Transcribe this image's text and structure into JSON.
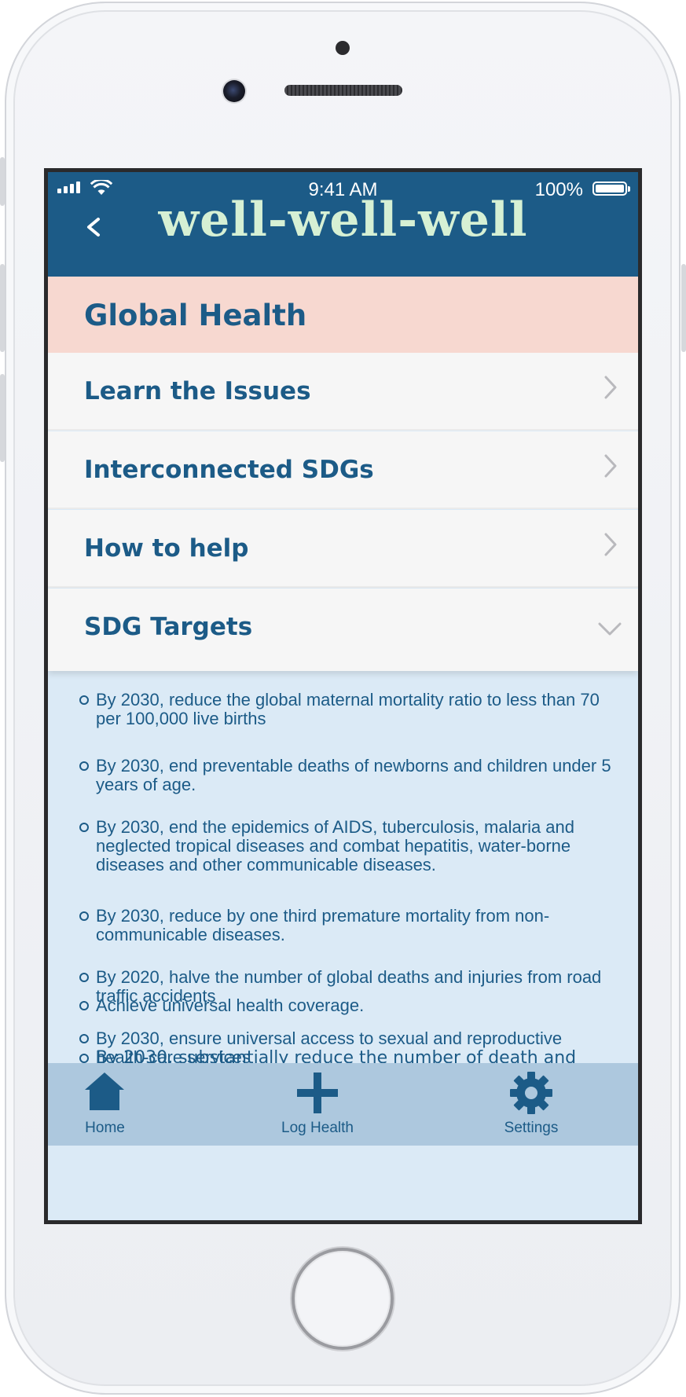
{
  "status_bar": {
    "time": "9:41 AM",
    "battery": "100%"
  },
  "header": {
    "app_title": "well-well-well"
  },
  "section": {
    "title": "Global Health"
  },
  "menu": {
    "items": [
      {
        "label": "Learn the Issues"
      },
      {
        "label": "Interconnected SDGs"
      },
      {
        "label": "How to help"
      },
      {
        "label": "SDG Targets"
      }
    ]
  },
  "targets": [
    {
      "text": "By 2030, reduce the global maternal mortality ratio to less than 70 per 100,000 live births"
    },
    {
      "text": "By 2030, end preventable deaths of newborns and children under 5 years of age."
    },
    {
      "text": "By 2030, end the epidemics of AIDS, tuberculosis, malaria and neglected tropical diseases and combat hepatitis, water-borne diseases and other communicable diseases."
    },
    {
      "text": "By 2030, reduce by one third premature mortality from non-communicable diseases."
    },
    {
      "text": "By 2020, halve the number of global deaths and injuries from road traffic accidents"
    },
    {
      "text": "By 2030, ensure universal access to sexual and reproductive health-care services"
    },
    {
      "text": "Achieve universal health coverage."
    },
    {
      "text": "By 2030, substantially reduce the number of death and"
    }
  ],
  "tab_bar": {
    "home": "Home",
    "log": "Log Health",
    "settings": "Settings"
  },
  "colors": {
    "header_bg": "#1c5b87",
    "title_color": "#d6f0d4",
    "section_bg": "#f7d8d0",
    "content_bg": "#dbeaf6",
    "tab_bg": "#adc8de"
  },
  "icons": {
    "back": "chevron-left-icon",
    "chevron": "chevron-right-icon",
    "expand": "chevron-down-icon",
    "home": "home-icon",
    "log": "plus-icon",
    "settings": "gear-icon"
  }
}
